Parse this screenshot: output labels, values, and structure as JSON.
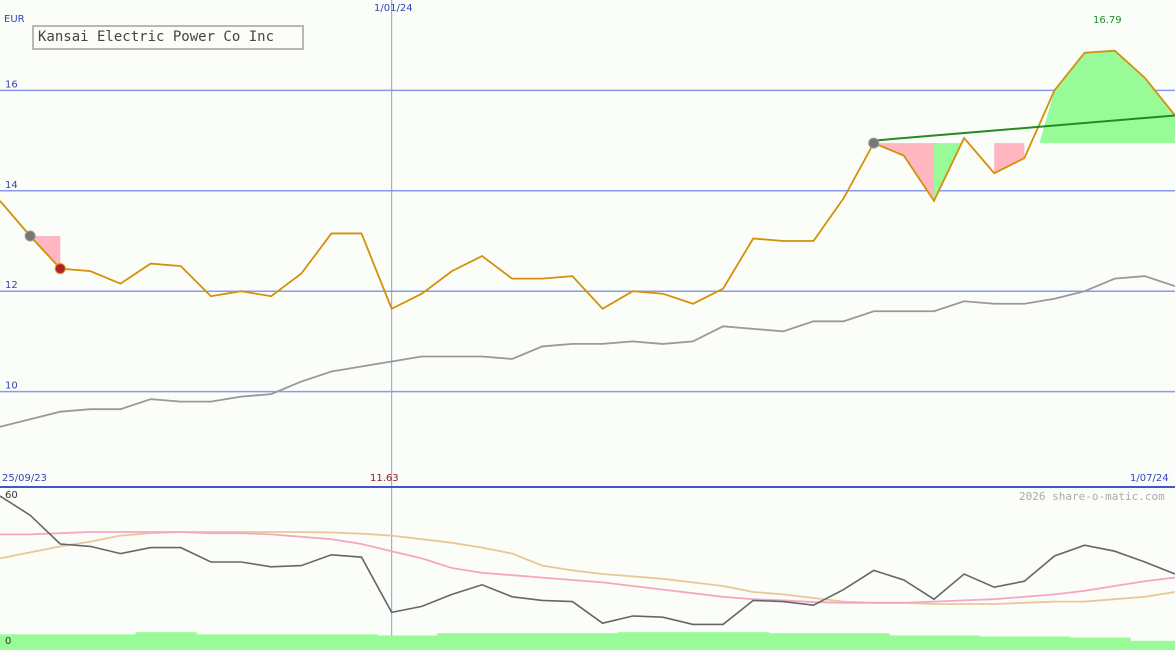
{
  "title": "Kansai Electric Power Co Inc",
  "currency": "EUR",
  "watermark": "2026 share-o-matic.com",
  "labels": {
    "date_start": "25/09/23",
    "date_mid": "1/01/24",
    "date_end": "1/07/24",
    "low_value": "11.63",
    "high_value": "16.79",
    "osc_max": "60",
    "osc_min": "0"
  },
  "colors": {
    "price": "#d4900a",
    "ma": "#999999",
    "trend": "#228b22",
    "gain_fill": "#98fb98",
    "loss_fill": "#ffb6c1",
    "grid": "#8899ee",
    "osc_main": "#666666",
    "osc_pink": "#f4a8c0",
    "osc_tan": "#e8c898",
    "volume": "#98fb98"
  },
  "chart_data": [
    {
      "type": "line",
      "title": "Kansai Electric Power Co Inc",
      "ylabel": "EUR",
      "ylim": [
        8.1,
        17.8
      ],
      "yticks": [
        10,
        12,
        14,
        16
      ],
      "x_range": [
        "25/09/23",
        "1/07/24"
      ],
      "series": [
        {
          "role": "price",
          "values": [
            13.8,
            13.1,
            12.45,
            12.4,
            12.15,
            12.55,
            12.5,
            11.9,
            12.0,
            11.9,
            12.35,
            13.15,
            13.15,
            11.65,
            11.95,
            12.4,
            12.7,
            12.25,
            12.25,
            12.3,
            11.65,
            12.0,
            11.95,
            11.75,
            12.05,
            13.05,
            13.0,
            13.0,
            13.85,
            14.95,
            14.7,
            13.8,
            15.05,
            14.35,
            14.65,
            16.0,
            16.75,
            16.79,
            16.25,
            15.5
          ]
        },
        {
          "role": "moving-average",
          "values": [
            9.3,
            9.45,
            9.6,
            9.65,
            9.65,
            9.85,
            9.8,
            9.8,
            9.9,
            9.95,
            10.2,
            10.4,
            10.5,
            10.6,
            10.7,
            10.7,
            10.7,
            10.65,
            10.9,
            10.95,
            10.95,
            11.0,
            10.95,
            11.0,
            11.3,
            11.25,
            11.2,
            11.4,
            11.4,
            11.6,
            11.6,
            11.6,
            11.8,
            11.75,
            11.75,
            11.85,
            12.0,
            12.25,
            12.3,
            12.1
          ]
        },
        {
          "role": "trend-line",
          "x_index": [
            29,
            39
          ],
          "values": [
            15.0,
            15.5
          ]
        }
      ],
      "markers": [
        {
          "x_index": 1,
          "value": 13.1,
          "kind": "grey"
        },
        {
          "x_index": 2,
          "value": 12.45,
          "kind": "red"
        },
        {
          "x_index": 29,
          "value": 14.95,
          "kind": "grey"
        }
      ]
    },
    {
      "type": "line",
      "ylim": [
        0,
        60
      ],
      "series": [
        {
          "role": "oscillator",
          "values": [
            60,
            52,
            40,
            39,
            36,
            38.5,
            38.5,
            32.5,
            32.5,
            30.5,
            31,
            35.5,
            34.5,
            11.5,
            14,
            19,
            23,
            18,
            16.5,
            16,
            7,
            10,
            9.5,
            6.5,
            6.5,
            16.5,
            16,
            14.5,
            21,
            29,
            25,
            17,
            27.5,
            22,
            24.5,
            35,
            39.5,
            37,
            32.5,
            27.5
          ]
        },
        {
          "role": "signal-pink",
          "values": [
            44,
            44,
            44.5,
            45,
            45,
            45,
            45,
            44.5,
            44.5,
            44,
            43,
            42,
            40,
            37,
            34,
            30,
            28,
            27,
            26,
            25,
            24,
            22.5,
            21,
            19.5,
            18,
            17,
            16.5,
            15.8,
            15.5,
            15.5,
            15.5,
            16,
            16.5,
            17,
            18,
            19,
            20.5,
            22.5,
            24.5,
            26
          ]
        },
        {
          "role": "signal-tan",
          "values": [
            34,
            36.5,
            39,
            41,
            43.5,
            44.5,
            45,
            45,
            45,
            45,
            45,
            44.8,
            44.3,
            43.5,
            42,
            40.5,
            38.5,
            36,
            31,
            29,
            27.5,
            26.5,
            25.5,
            24,
            22.5,
            20,
            19,
            17.5,
            16,
            15.5,
            15.5,
            15,
            15,
            15,
            15.5,
            16,
            16,
            17,
            18,
            20
          ]
        }
      ],
      "volume": [
        6,
        6,
        6,
        6,
        6,
        7,
        7,
        6,
        6,
        6,
        6,
        6,
        6,
        5.5,
        5.5,
        6.5,
        6.5,
        6.5,
        6.5,
        6.5,
        6.5,
        7,
        7,
        7,
        7,
        7,
        6.5,
        6.5,
        6.5,
        6.5,
        5.5,
        5.5,
        5.5,
        5,
        5,
        5,
        4.5,
        4.5,
        3,
        3
      ]
    }
  ]
}
